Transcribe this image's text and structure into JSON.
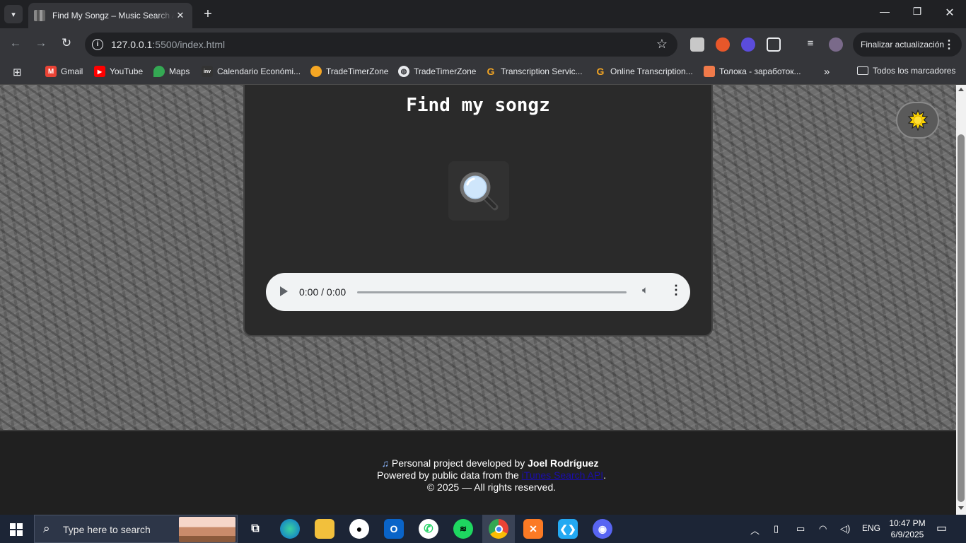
{
  "browser": {
    "tab_title": "Find My Songz – Music Search App",
    "url_host": "127.0.0.1",
    "url_rest": ":5500/index.html",
    "update_button": "Finalizar actualización",
    "bookmarks": [
      {
        "label": "Gmail",
        "icon": "gmail-icon"
      },
      {
        "label": "YouTube",
        "icon": "youtube-icon"
      },
      {
        "label": "Maps",
        "icon": "maps-icon"
      },
      {
        "label": "Calendario Económi...",
        "icon": "investing-icon"
      },
      {
        "label": "TradeTimerZone",
        "icon": "tradetimer-icon"
      },
      {
        "label": "TradeTimerZone",
        "icon": "globe-icon"
      },
      {
        "label": "Transcription Servic...",
        "icon": "g-icon"
      },
      {
        "label": "Online Transcription...",
        "icon": "g-icon"
      },
      {
        "label": "Толока - заработок...",
        "icon": "toloka-icon"
      }
    ],
    "all_bookmarks": "Todos los marcadores"
  },
  "app": {
    "title": "Find my songz",
    "audio_time": "0:00 / 0:00",
    "colors": {
      "card": "#2a2a2a",
      "accent_sun": "#ffd700"
    }
  },
  "footer": {
    "line1_prefix": "Personal project developed by ",
    "author": "Joel Rodríguez",
    "line2_prefix": "Powered by public data from the ",
    "api_link": "iTunes Search API",
    "line2_suffix": ".",
    "line3": "© 2025 — All rights reserved."
  },
  "taskbar": {
    "search_placeholder": "Type here to search",
    "language": "ENG",
    "time": "10:47 PM",
    "date": "6/9/2025"
  }
}
